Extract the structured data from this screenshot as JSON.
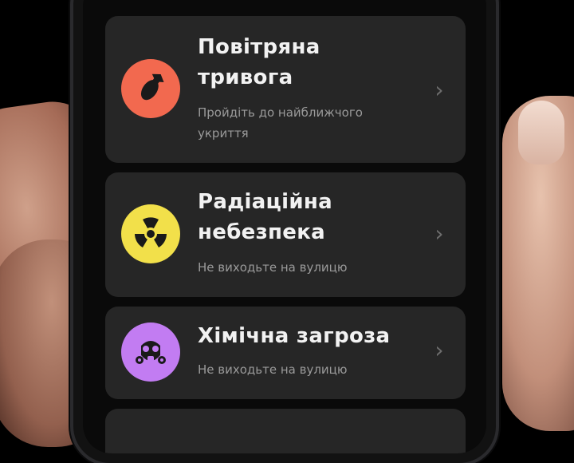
{
  "alerts": [
    {
      "title_line1": "Повітряна",
      "title_line2": "тривога",
      "subtitle_line1": "Пройдіть до найближчого",
      "subtitle_line2": "укриття",
      "icon": "bomb-icon",
      "color": "#f2694f"
    },
    {
      "title_line1": "Радіаційна",
      "title_line2": "небезпека",
      "subtitle_line1": "Не виходьте на вулицю",
      "icon": "radiation-icon",
      "color": "#f2e04a"
    },
    {
      "title_line1": "Хімічна загроза",
      "subtitle_line1": "Не виходьте на вулицю",
      "icon": "gas-mask-icon",
      "color": "#c27cf2"
    }
  ],
  "chevron_icon": "chevron-right-icon"
}
